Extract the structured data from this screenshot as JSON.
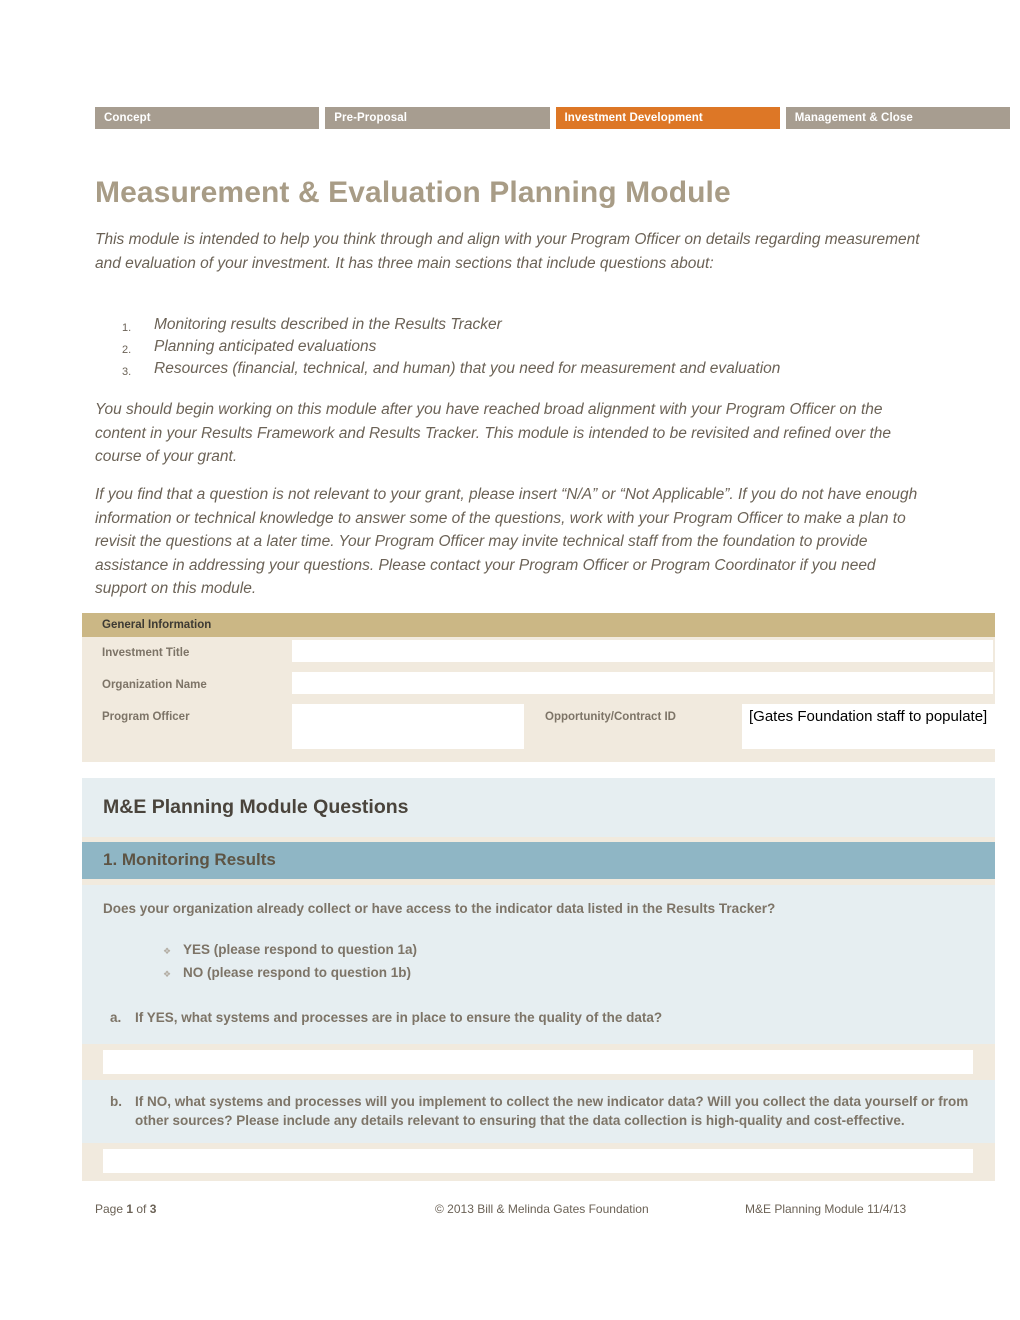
{
  "stages": {
    "tabs": [
      {
        "label": "Concept",
        "active": false
      },
      {
        "label": "Pre-Proposal",
        "active": false
      },
      {
        "label": "Investment Development",
        "active": true
      },
      {
        "label": "Management & Close",
        "active": false
      }
    ],
    "active_color": "#dd7726",
    "inactive_color": "#a79d90"
  },
  "document": {
    "title": "Measurement & Evaluation Planning Module",
    "title_color": "#a89c86",
    "intro_paragraph": "This module is intended to help you think through and align with your Program Officer on details regarding measurement and evaluation of your investment. It has three main sections that include questions about:",
    "numbered_items": [
      {
        "num": "1.",
        "text": "Monitoring results described in the Results Tracker"
      },
      {
        "num": "2.",
        "text": "Planning anticipated evaluations"
      },
      {
        "num": "3.",
        "text": "Resources (financial, technical, and human) that you need for measurement and evaluation"
      }
    ],
    "paragraph_2": "You should begin working on this module after you have reached broad alignment with your Program Officer on the content in your Results Framework and Results Tracker. This module is intended to be revisited and refined over the course of your grant.",
    "paragraph_3": "If you find that a question is not relevant to your grant, please insert “N/A” or “Not Applicable”.  If you do not have enough information or technical knowledge to answer some of the questions, work with your Program Officer to make a plan to revisit the questions at a later time. Your Program Officer may invite technical staff from the foundation to provide assistance in addressing  your questions.  Please contact your Program Officer or Program Coordinator if you need support on this module."
  },
  "general_information": {
    "header": "General Information",
    "header_color": "#cbb785",
    "body_color": "#f1eade",
    "investment_title_label": "Investment Title",
    "investment_title_value": "",
    "organization_name_label": "Organization Name",
    "organization_name_value": "",
    "program_officer_label": "Program Officer",
    "program_officer_value": "",
    "opportunity_contract_id_label": "Opportunity/Contract ID",
    "opportunity_contract_id_value": "[Gates Foundation staff to populate]"
  },
  "questions": {
    "panel_title": "M&E Planning Module Questions",
    "section_1": {
      "heading": "1. Monitoring Results",
      "heading_color": "#8fb6c5",
      "prompt": "Does your organization already collect or have access to the indicator data listed in the Results Tracker?",
      "choices": [
        {
          "glyph": "❖",
          "label": "YES  (please respond to question 1a)"
        },
        {
          "glyph": "❖",
          "label": "NO  (please respond to question 1b)"
        }
      ],
      "sub_a": {
        "marker": "a.",
        "text": "If YES, what systems and processes are in place to ensure the quality of the data?",
        "answer_value": ""
      },
      "sub_b": {
        "marker": "b.",
        "text": "If NO, what systems and processes will you implement to collect the new indicator data? Will you collect the data yourself or from other sources? Please include any details relevant to ensuring that the data collection is high-quality and cost-effective.",
        "answer_value": ""
      }
    }
  },
  "footer": {
    "page_prefix": "Page ",
    "page_number": "1",
    "page_mid": " of ",
    "page_total": "3",
    "copyright": "© 2013 Bill & Melinda Gates Foundation",
    "module_label": "M&E Planning Module 11/4/13"
  }
}
